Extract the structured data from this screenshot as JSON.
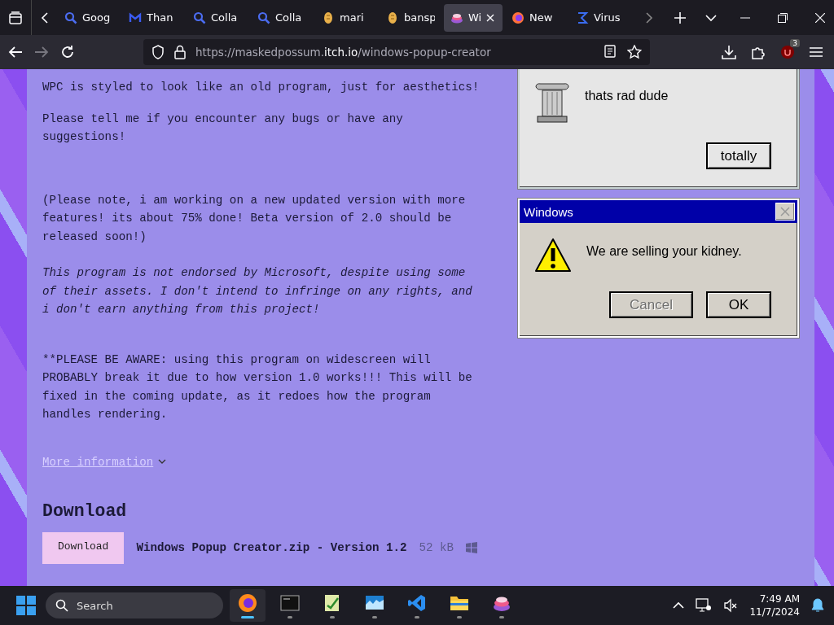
{
  "browser": {
    "tabs": [
      {
        "label": "Goog",
        "selected": false
      },
      {
        "label": "Than",
        "selected": false
      },
      {
        "label": "Colla",
        "selected": false
      },
      {
        "label": "Colla",
        "selected": false
      },
      {
        "label": "mari",
        "selected": false
      },
      {
        "label": "bansp",
        "selected": false
      },
      {
        "label": "Wi",
        "selected": true
      },
      {
        "label": "New",
        "selected": false
      },
      {
        "label": "Virus",
        "selected": false
      }
    ],
    "url_host": "https://maskedpossum.",
    "url_domain": "itch.io",
    "url_path": "/windows-popup-creator",
    "extension_badge": "3"
  },
  "page": {
    "paragraphs": [
      {
        "text": "WPC is styled to look like an old program, just for aesthetics!",
        "kind": "plain"
      },
      {
        "text": "Please tell me if you encounter any bugs or have any suggestions!",
        "kind": "plain"
      },
      {
        "text": "(Please note, i am working on a new updated version with more features! its about 75% done! Beta version of 2.0 should be released soon!)",
        "kind": "plain"
      },
      {
        "text": "This program is not endorsed by Microsoft, despite using some of their assets. I don't intend to infringe on any rights, and i don't earn anything from this project!",
        "kind": "italic"
      },
      {
        "text": "**PLEASE BE AWARE: using this program on widescreen will PROBABLY break it due to how version 1.0 works!!! This will be fixed in the coming update, as it redoes how the program handles rendering.",
        "kind": "plain"
      }
    ],
    "more_link": "More information",
    "download_heading": "Download",
    "download_button": "Download",
    "file_name": "Windows Popup Creator.zip - Version 1.2",
    "file_size": "52 kB"
  },
  "dialogs": [
    {
      "message": "thats rad dude",
      "buttons": [
        {
          "label": "totally",
          "disabled": false
        }
      ]
    },
    {
      "title": "Windows",
      "message": "We are selling your kidney.",
      "buttons": [
        {
          "label": "Cancel",
          "disabled": true
        },
        {
          "label": "OK",
          "disabled": false
        }
      ]
    }
  ],
  "taskbar": {
    "search_placeholder": "Search",
    "apps": [
      {
        "active": true
      },
      {
        "active": false
      },
      {
        "active": false
      },
      {
        "active": false
      },
      {
        "active": false
      },
      {
        "active": false
      },
      {
        "active": false
      }
    ],
    "time": "7:49 AM",
    "date": "11/7/2024"
  }
}
